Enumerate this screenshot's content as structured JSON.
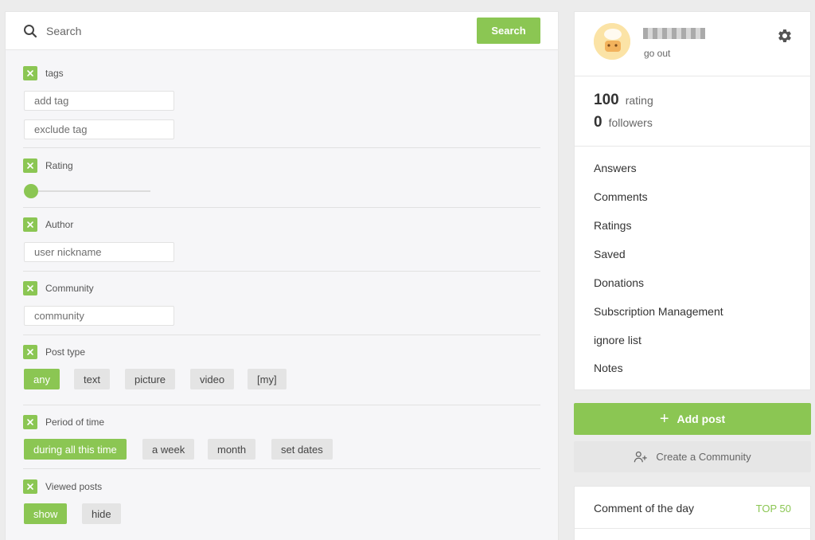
{
  "search": {
    "placeholder": "Search",
    "button_label": "Search"
  },
  "filters": {
    "tags": {
      "title": "tags",
      "add_placeholder": "add tag",
      "exclude_placeholder": "exclude tag"
    },
    "rating": {
      "title": "Rating",
      "value": 0
    },
    "author": {
      "title": "Author",
      "placeholder": "user nickname"
    },
    "community": {
      "title": "Community",
      "placeholder": "community"
    },
    "post_type": {
      "title": "Post type",
      "options": [
        "any",
        "text",
        "picture",
        "video",
        "[my]"
      ],
      "selected": "any"
    },
    "period": {
      "title": "Period of time",
      "options": [
        "during all this time",
        "a week",
        "month",
        "set dates"
      ],
      "selected": "during all this time"
    },
    "viewed": {
      "title": "Viewed posts",
      "options": [
        "show",
        "hide"
      ],
      "selected": "show"
    }
  },
  "profile": {
    "username": "username",
    "go_out": "go out",
    "rating_value": "100",
    "rating_label": "rating",
    "followers_value": "0",
    "followers_label": "followers"
  },
  "menu": [
    "Answers",
    "Comments",
    "Ratings",
    "Saved",
    "Donations",
    "Subscription Management",
    "ignore list",
    "Notes"
  ],
  "actions": {
    "add_post": "Add post",
    "create_community": "Create a Community"
  },
  "comment_of_day": {
    "title": "Comment of the day",
    "top_link": "TOP 50"
  },
  "colors": {
    "accent": "#8bc653",
    "chip": "#e4e4e4",
    "panel": "#f6f6f8"
  }
}
